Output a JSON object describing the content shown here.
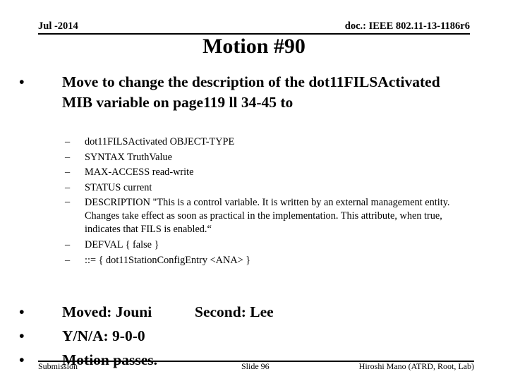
{
  "header": {
    "date": "Jul -2014",
    "doc_id": "doc.: IEEE 802.11-13-1186r6"
  },
  "slide": {
    "title": "Motion #90",
    "main_bullet": {
      "bullet": "•",
      "text": "Move to change the description of the dot11FILSActivated MIB variable on page119 ll 34-45 to"
    },
    "sub_bullets": [
      {
        "dash": "–",
        "text": "dot11FILSActivated OBJECT-TYPE"
      },
      {
        "dash": "–",
        "text": "SYNTAX TruthValue"
      },
      {
        "dash": "–",
        "text": "MAX-ACCESS read-write"
      },
      {
        "dash": "–",
        "text": "STATUS current"
      },
      {
        "dash": "–",
        "text": "DESCRIPTION \"This is a control variable. It is written by an external management entity. Changes take effect as soon as practical in the implementation. This attribute, when true, indicates that FILS is enabled.“"
      },
      {
        "dash": "–",
        "text": "DEFVAL { false }"
      },
      {
        "dash": "–",
        "text": "::= { dot11StationConfigEntry <ANA> }"
      }
    ],
    "results": {
      "moved": "Moved: Jouni",
      "second": "Second: Lee",
      "vote": "Y/N/A: 9-0-0",
      "outcome": "Motion passes.",
      "bullet": "•"
    }
  },
  "footer": {
    "left": "Submission",
    "center": "Slide 96",
    "right": "Hiroshi Mano (ATRD, Root, Lab)"
  }
}
